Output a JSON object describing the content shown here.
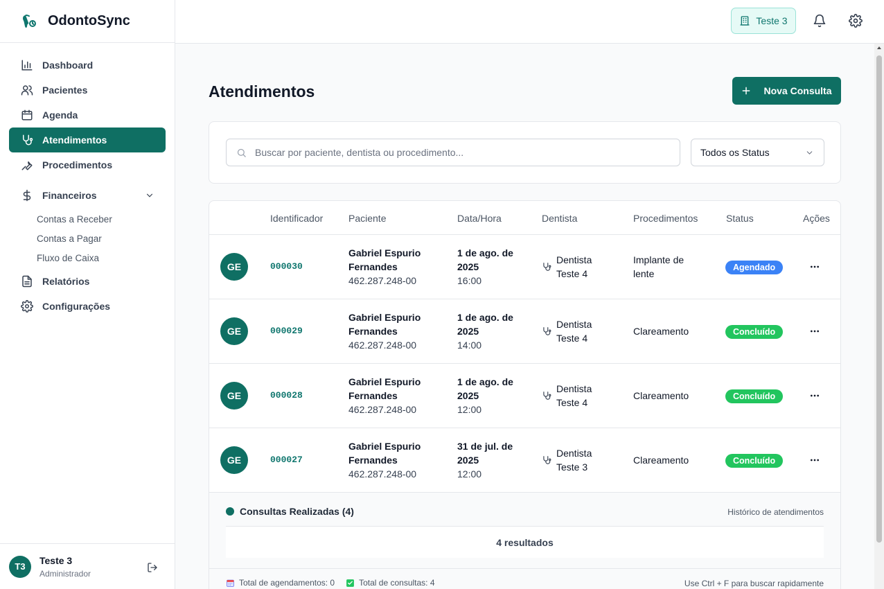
{
  "app": {
    "name": "OdontoSync"
  },
  "sidebar": {
    "items": [
      {
        "label": "Dashboard"
      },
      {
        "label": "Pacientes"
      },
      {
        "label": "Agenda"
      },
      {
        "label": "Atendimentos"
      },
      {
        "label": "Procedimentos"
      },
      {
        "label": "Financeiros"
      },
      {
        "label": "Relatórios"
      },
      {
        "label": "Configurações"
      }
    ],
    "financeiros_sub": [
      {
        "label": "Contas a Receber"
      },
      {
        "label": "Contas a Pagar"
      },
      {
        "label": "Fluxo de Caixa"
      }
    ],
    "active_item": "Atendimentos"
  },
  "user": {
    "initials": "T3",
    "name": "Teste 3",
    "role": "Administrador"
  },
  "topbar": {
    "clinic_label": "Teste 3"
  },
  "page": {
    "title": "Atendimentos",
    "new_button": "Nova Consulta"
  },
  "filters": {
    "search_placeholder": "Buscar por paciente, dentista ou procedimento...",
    "status_selected": "Todos os Status"
  },
  "table": {
    "columns": [
      "Identificador",
      "Paciente",
      "Data/Hora",
      "Dentista",
      "Procedimentos",
      "Status",
      "Ações"
    ],
    "rows": [
      {
        "initials": "GE",
        "id": "000030",
        "patient": "Gabriel Espurio Fernandes",
        "cpf": "462.287.248-00",
        "date": "1 de ago. de 2025",
        "time": "16:00",
        "dentist": "Dentista Teste 4",
        "procedure": "Implante de lente",
        "status": "Agendado",
        "status_color": "#3b82f6"
      },
      {
        "initials": "GE",
        "id": "000029",
        "patient": "Gabriel Espurio Fernandes",
        "cpf": "462.287.248-00",
        "date": "1 de ago. de 2025",
        "time": "14:00",
        "dentist": "Dentista Teste 4",
        "procedure": "Clareamento",
        "status": "Concluído",
        "status_color": "#22c55e"
      },
      {
        "initials": "GE",
        "id": "000028",
        "patient": "Gabriel Espurio Fernandes",
        "cpf": "462.287.248-00",
        "date": "1 de ago. de 2025",
        "time": "12:00",
        "dentist": "Dentista Teste 4",
        "procedure": "Clareamento",
        "status": "Concluído",
        "status_color": "#22c55e"
      },
      {
        "initials": "GE",
        "id": "000027",
        "patient": "Gabriel Espurio Fernandes",
        "cpf": "462.287.248-00",
        "date": "31 de jul. de 2025",
        "time": "12:00",
        "dentist": "Dentista Teste 3",
        "procedure": "Clareamento",
        "status": "Concluído",
        "status_color": "#22c55e"
      }
    ]
  },
  "summary": {
    "title": "Consultas Realizadas (4)",
    "subtitle": "Histórico de atendimentos",
    "results": "4 resultados",
    "total_appointments": "Total de agendamentos: 0",
    "total_consultations": "Total de consultas: 4",
    "hint": "Use Ctrl + F para buscar rapidamente"
  },
  "colors": {
    "brand": "#0f6f63",
    "scheduled": "#3b82f6",
    "done": "#22c55e"
  }
}
